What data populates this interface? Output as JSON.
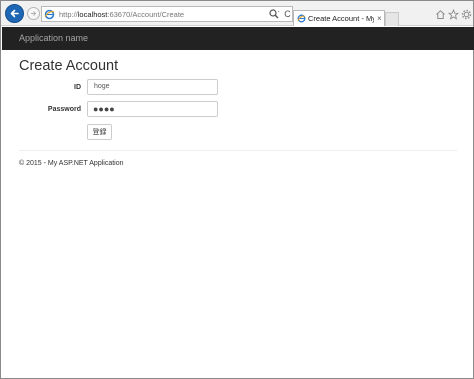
{
  "browser": {
    "address_scheme": "http://",
    "address_host": "localhost",
    "address_path": ":63670/Account/Create",
    "tab_title": "Create Account - My ASP....",
    "tab_close": "×",
    "refresh_glyph": "C"
  },
  "navbar": {
    "brand": "Application name"
  },
  "page": {
    "title": "Create Account"
  },
  "form": {
    "id_label": "ID",
    "id_value": "hoge",
    "password_label": "Password",
    "password_mask": "●●●●",
    "submit_label": "登録"
  },
  "footer": {
    "text": "© 2015 - My ASP.NET Application"
  },
  "colors": {
    "navbar_bg": "#222222",
    "back_button": "#1e67b5"
  }
}
